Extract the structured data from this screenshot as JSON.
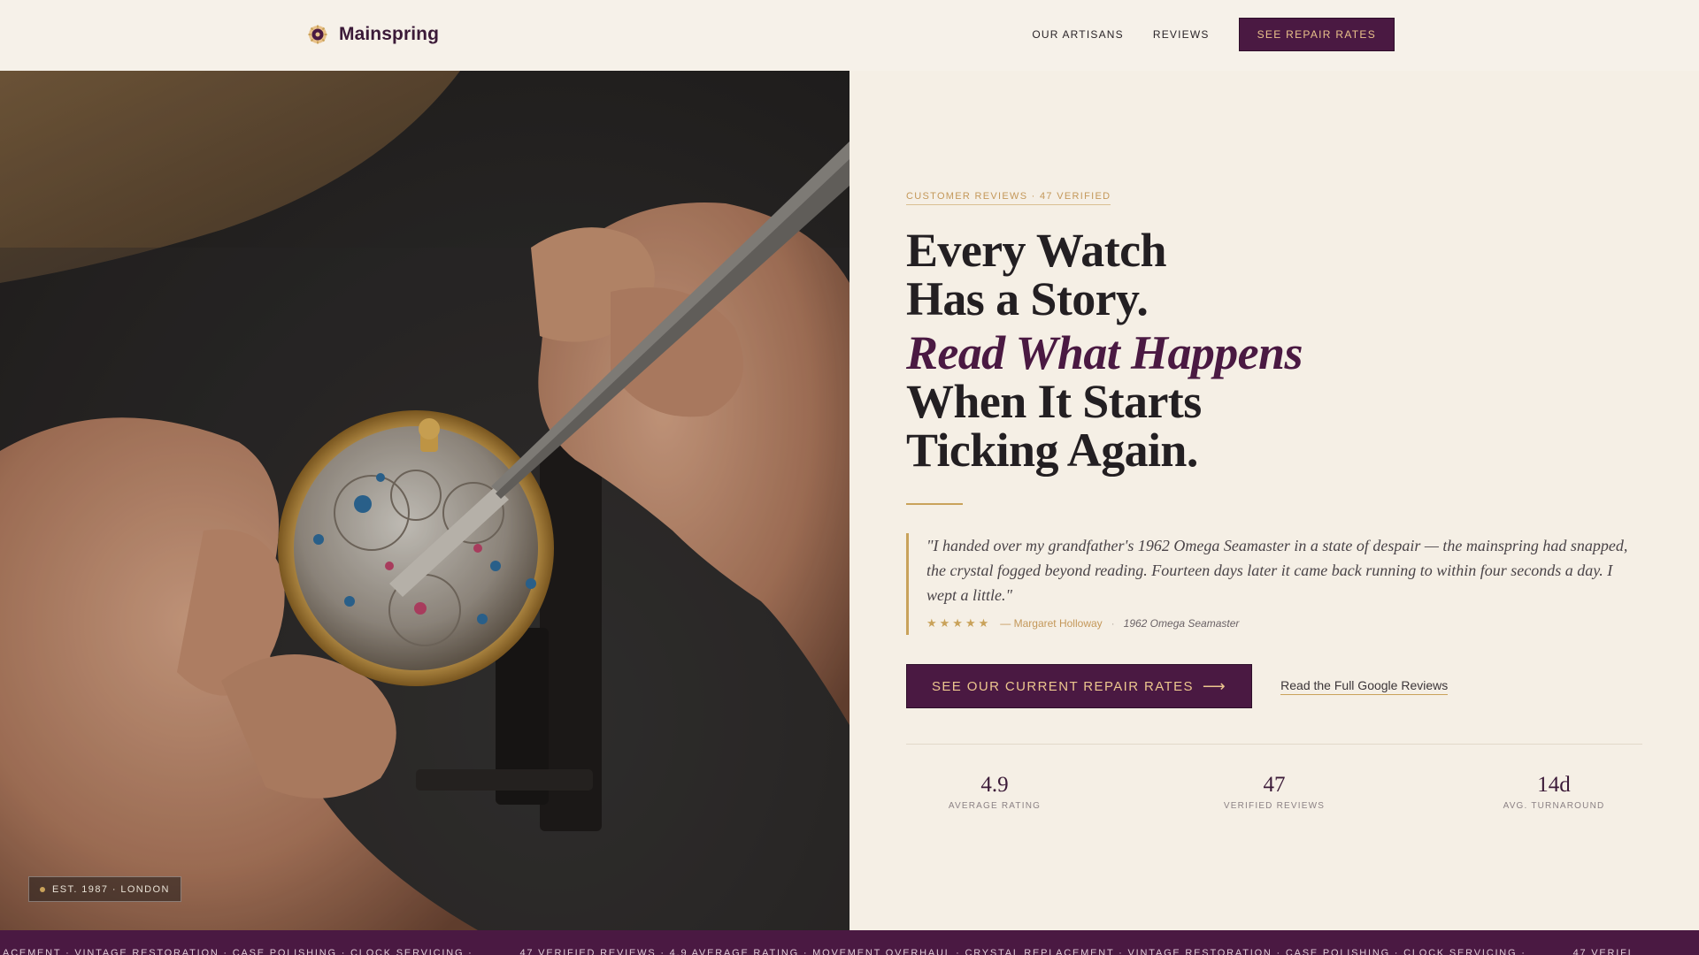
{
  "header": {
    "brand_name": "Mainspring",
    "brand_logo_icon": "watch-gear-icon",
    "nav": [
      {
        "label": "OUR ARTISANS"
      },
      {
        "label": "REVIEWS"
      }
    ],
    "cta_label": "SEE REPAIR RATES"
  },
  "hero_image": {
    "subject": "watchmaker-hands-tweezers-movement",
    "badge_label": "EST. 1987 · LONDON"
  },
  "content": {
    "eyebrow": "CUSTOMER REVIEWS · 47 VERIFIED",
    "headline": {
      "line1": "Every Watch",
      "line2": "Has a Story.",
      "line3": "Read What Happens",
      "line4": "When It Starts",
      "line5": "Ticking Again."
    },
    "quote": {
      "text": "\"I handed over my grandfather's 1962 Omega Seamaster in a state of despair — the mainspring had snapped, the crystal fogged beyond reading. Fourteen days later it came back running to within four seconds a day. I wept a little.\"",
      "stars": "★★★★★",
      "rating": 5,
      "author": "— Margaret Holloway",
      "separator": "·",
      "watch": "1962 Omega Seamaster"
    },
    "cta_primary": "SEE OUR CURRENT REPAIR RATES",
    "cta_arrow": "⟶",
    "cta_secondary": "Read the Full Google Reviews",
    "stats": [
      {
        "value": "4.9",
        "label": "AVERAGE RATING"
      },
      {
        "value": "47",
        "label": "VERIFIED REVIEWS"
      },
      {
        "value": "14d",
        "label": "AVG. TURNAROUND"
      }
    ]
  },
  "marquee": {
    "items": [
      "PLACEMENT · VINTAGE RESTORATION · CASE POLISHING · CLOCK SERVICING ·",
      "47 VERIFIED REVIEWS · 4.9 AVERAGE RATING · MOVEMENT OVERHAUL · CRYSTAL REPLACEMENT · VINTAGE RESTORATION · CASE POLISHING · CLOCK SERVICING ·",
      "47 VERIFI"
    ]
  },
  "colors": {
    "background": "#f5efe5",
    "plum": "#4a1942",
    "gold": "#c9a25a",
    "ink": "#231f22"
  }
}
